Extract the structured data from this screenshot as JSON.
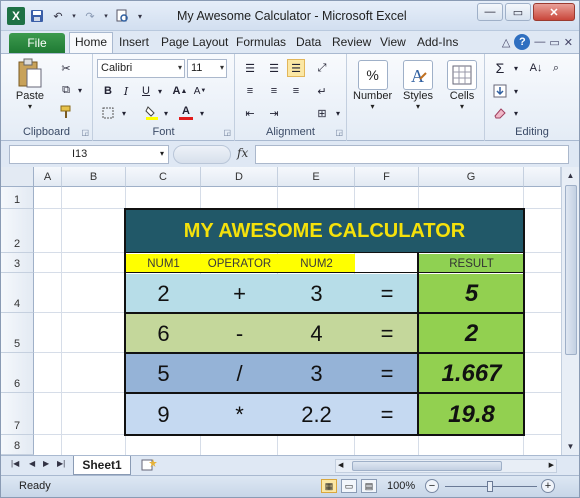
{
  "window": {
    "title": "My Awesome Calculator  -  Microsoft Excel",
    "app_icon_letter": "X"
  },
  "tabs": {
    "file": "File",
    "items": [
      "Home",
      "Insert",
      "Page Layout",
      "Formulas",
      "Data",
      "Review",
      "View",
      "Add-Ins"
    ],
    "active": "Home"
  },
  "ribbon": {
    "clipboard": {
      "label": "Clipboard",
      "paste": "Paste"
    },
    "font": {
      "label": "Font",
      "family": "Calibri",
      "size": "11",
      "bold": "B",
      "italic": "I",
      "underline": "U"
    },
    "alignment": {
      "label": "Alignment"
    },
    "number": {
      "label": "Number",
      "symbol": "%"
    },
    "styles": {
      "label": "Styles"
    },
    "cells": {
      "label": "Cells"
    },
    "editing": {
      "label": "Editing",
      "sum_symbol": "Σ"
    }
  },
  "formula_bar": {
    "name_box": "I13",
    "fx": "fx",
    "value": ""
  },
  "grid": {
    "columns": [
      "A",
      "B",
      "C",
      "D",
      "E",
      "F",
      "G"
    ],
    "rows": [
      "1",
      "2",
      "3",
      "4",
      "5",
      "6",
      "7",
      "8"
    ]
  },
  "calculator": {
    "title": "MY AWESOME CALCULATOR",
    "headers": {
      "num1": "NUM1",
      "operator": "OPERATOR",
      "num2": "NUM2",
      "result": "RESULT"
    },
    "rows": [
      {
        "num1": "2",
        "operator": "+",
        "num2": "3",
        "equals": "=",
        "result": "5"
      },
      {
        "num1": "6",
        "operator": "-",
        "num2": "4",
        "equals": "=",
        "result": "2"
      },
      {
        "num1": "5",
        "operator": "/",
        "num2": "3",
        "equals": "=",
        "result": "1.667"
      },
      {
        "num1": "9",
        "operator": "*",
        "num2": "2.2",
        "equals": "=",
        "result": "19.8"
      }
    ]
  },
  "sheet_tabs": {
    "active": "Sheet1"
  },
  "status_bar": {
    "status": "Ready",
    "zoom": "100%",
    "zoom_level_percent": 100
  },
  "colors": {
    "title_bg": "#215868",
    "title_text": "#f5e10b",
    "header_yellow": "#ffff00",
    "result_green": "#92d050",
    "row_colors": [
      "#b7dde8",
      "#c4d79b",
      "#95b3d7",
      "#c5d9f1"
    ],
    "file_tab": "#1f7a34"
  }
}
